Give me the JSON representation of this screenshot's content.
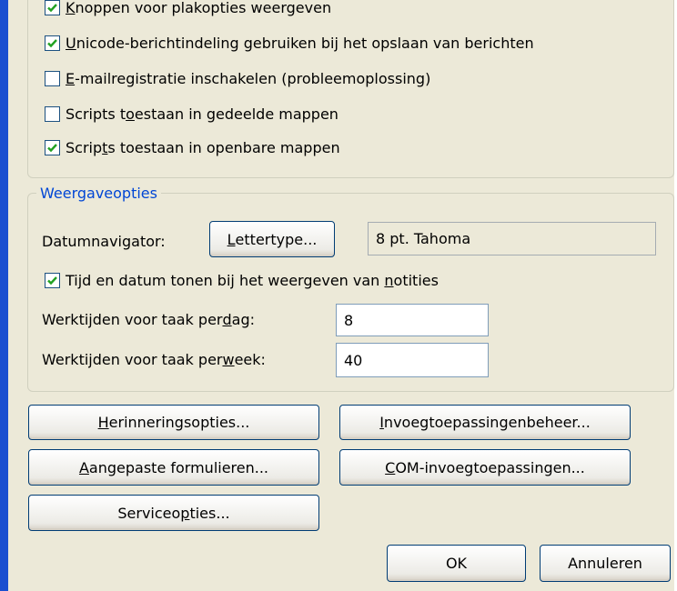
{
  "general_options": {
    "items": [
      {
        "pre": "",
        "acc": "K",
        "post": "noppen voor plakopties weergeven",
        "checked": true
      },
      {
        "pre": "",
        "acc": "U",
        "post": "nicode-berichtindeling gebruiken bij het opslaan van berichten",
        "checked": true
      },
      {
        "pre": "",
        "acc": "E",
        "post": "-mailregistratie inschakelen (probleemoplossing)",
        "checked": false
      },
      {
        "pre": "Scripts t",
        "acc": "o",
        "post": "estaan in gedeelde mappen",
        "checked": false
      },
      {
        "pre": "Scrip",
        "acc": "t",
        "post": "s toestaan in openbare mappen",
        "checked": true
      }
    ]
  },
  "weergave": {
    "legend": "Weergaveopties",
    "datumnavigator_label": "Datumnavigator:",
    "lettertype_button": {
      "acc": "L",
      "rest": "ettertype..."
    },
    "font_value": "8 pt. Tahoma",
    "tijd_checkbox": {
      "pre": "Tijd en datum tonen bij het weergeven van ",
      "acc": "n",
      "post": "otities",
      "checked": true
    },
    "werk_dag": {
      "pre": "Werktijden voor taak per ",
      "acc": "d",
      "post": "ag:",
      "value": "8"
    },
    "werk_week": {
      "pre": "Werktijden voor taak per ",
      "acc": "w",
      "post": "eek:",
      "value": "40"
    }
  },
  "buttons": {
    "herinnering": {
      "pre": "",
      "acc": "H",
      "post": "erinneringsopties..."
    },
    "invoeg": {
      "pre": "",
      "acc": "I",
      "post": "nvoegtoepassingenbeheer..."
    },
    "aangepast": {
      "pre": "",
      "acc": "A",
      "post": "angepaste formulieren..."
    },
    "com": {
      "pre": "",
      "acc": "C",
      "post": "OM-invoegtoepassingen..."
    },
    "service": {
      "pre": "Serviceo",
      "acc": "p",
      "post": "ties..."
    },
    "ok": "OK",
    "annuleren": "Annuleren"
  },
  "colors": {
    "accent": "#0046d5",
    "window_bg": "#ece9d8",
    "frame_blue": "#1a4fd0"
  }
}
